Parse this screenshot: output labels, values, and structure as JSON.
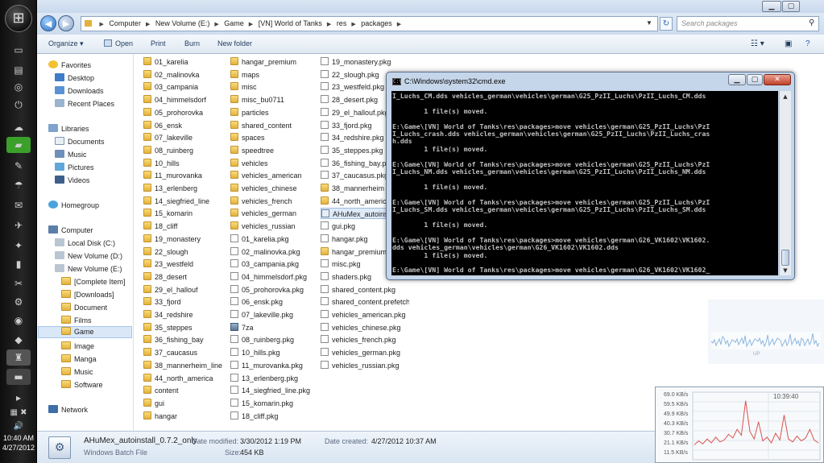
{
  "taskbar": {
    "clock_time": "10:40 AM",
    "clock_date": "4/27/2012"
  },
  "explorer": {
    "breadcrumb": [
      "Computer",
      "New Volume (E:)",
      "Game",
      "[VN] World of Tanks",
      "res",
      "packages"
    ],
    "search_placeholder": "Search packages",
    "toolbar": {
      "organize": "Organize",
      "open": "Open",
      "print": "Print",
      "burn": "Burn",
      "new_folder": "New folder"
    },
    "nav": {
      "favorites": "Favorites",
      "desktop": "Desktop",
      "downloads": "Downloads",
      "recent_places": "Recent Places",
      "libraries": "Libraries",
      "documents": "Documents",
      "music": "Music",
      "pictures": "Pictures",
      "videos": "Videos",
      "homegroup": "Homegroup",
      "computer": "Computer",
      "local_disk": "Local Disk (C:)",
      "volume_d": "New Volume (D:)",
      "volume_e": "New Volume (E:)",
      "complete_item": "[Complete Item]",
      "downloads_folder": "[Downloads]",
      "document": "Document",
      "films": "Films",
      "game": "Game",
      "image": "Image",
      "manga": "Manga",
      "music2": "Music",
      "software": "Software",
      "network": "Network"
    },
    "files_col1": [
      "01_karelia",
      "02_malinovka",
      "03_campania",
      "04_himmelsdorf",
      "05_prohorovka",
      "06_ensk",
      "07_lakeville",
      "08_ruinberg",
      "10_hills",
      "11_murovanka",
      "13_erlenberg",
      "14_siegfried_line",
      "15_komarin",
      "18_cliff",
      "19_monastery",
      "22_slough",
      "23_westfeld",
      "28_desert",
      "29_el_hallouf",
      "33_fjord",
      "34_redshire",
      "35_steppes",
      "36_fishing_bay",
      "37_caucasus",
      "38_mannerheim_line",
      "44_north_america",
      "content",
      "gui",
      "hangar"
    ],
    "files_col2": [
      "hangar_premium",
      "maps",
      "misc",
      "misc_bu0711",
      "particles",
      "shared_content",
      "spaces",
      "speedtree",
      "vehicles",
      "vehicles_american",
      "vehicles_chinese",
      "vehicles_french",
      "vehicles_german",
      "vehicles_russian",
      "01_karelia.pkg",
      "02_malinovka.pkg",
      "03_campania.pkg",
      "04_himmelsdorf.pkg",
      "05_prohorovka.pkg",
      "06_ensk.pkg",
      "07_lakeville.pkg",
      "7za",
      "08_ruinberg.pkg",
      "10_hills.pkg",
      "11_murovanka.pkg",
      "13_erlenberg.pkg",
      "14_siegfried_line.pkg",
      "15_komarin.pkg",
      "18_cliff.pkg"
    ],
    "files_col3": [
      "19_monastery.pkg",
      "22_slough.pkg",
      "23_westfeld.pkg",
      "28_desert.pkg",
      "29_el_hallouf.pkg",
      "33_fjord.pkg",
      "34_redshire.pkg",
      "35_steppes.pkg",
      "36_fishing_bay.p",
      "37_caucasus.pkg",
      "38_mannerheim",
      "44_north_americ",
      "AHuMex_autoinst",
      "gui.pkg",
      "hangar.pkg",
      "hangar_premium",
      "misc.pkg",
      "shaders.pkg",
      "shared_content.pkg",
      "shared_content.prefetch",
      "vehicles_american.pkg",
      "vehicles_chinese.pkg",
      "vehicles_french.pkg",
      "vehicles_german.pkg",
      "vehicles_russian.pkg"
    ],
    "details": {
      "name": "AHuMex_autoinstall_0.7.2_only",
      "type": "Windows Batch File",
      "modified_label": "Date modified:",
      "modified_value": "3/30/2012 1:19 PM",
      "size_label": "Size:",
      "size_value": "454 KB",
      "created_label": "Date created:",
      "created_value": "4/27/2012 10:37 AM"
    }
  },
  "cmd": {
    "title": "C:\\Windows\\system32\\cmd.exe",
    "lines": [
      "I_Luchs_CM.dds vehicles_german\\vehicles\\german\\G25_PzII_Luchs\\PzII_Luchs_CM.dds",
      "",
      "        1 file(s) moved.",
      "",
      "E:\\Game\\[VN] World of Tanks\\res\\packages>move vehicles\\german\\G25_PzII_Luchs\\PzI",
      "I_Luchs_crash.dds vehicles_german\\vehicles\\german\\G25_PzII_Luchs\\PzII_Luchs_cras",
      "h.dds",
      "        1 file(s) moved.",
      "",
      "E:\\Game\\[VN] World of Tanks\\res\\packages>move vehicles\\german\\G25_PzII_Luchs\\PzI",
      "I_Luchs_NM.dds vehicles_german\\vehicles\\german\\G25_PzII_Luchs\\PzII_Luchs_NM.dds",
      "",
      "        1 file(s) moved.",
      "",
      "E:\\Game\\[VN] World of Tanks\\res\\packages>move vehicles\\german\\G25_PzII_Luchs\\PzI",
      "I_Luchs_SM.dds vehicles_german\\vehicles\\german\\G25_PzII_Luchs\\PzII_Luchs_SM.dds",
      "",
      "        1 file(s) moved.",
      "",
      "E:\\Game\\[VN] World of Tanks\\res\\packages>move vehicles\\german\\G26_VK1602\\VK1602.",
      "dds vehicles_german\\vehicles\\german\\G26_VK1602\\VK1602.dds",
      "        1 file(s) moved.",
      "",
      "E:\\Game\\[VN] World of Tanks\\res\\packages>move vehicles\\german\\G26_VK1602\\VK1602_"
    ]
  },
  "netmon": {
    "time": "10:39:40",
    "levels": [
      "69.0 KB/s",
      "59.5 KB/s",
      "49.9 KB/s",
      "40.3 KB/s",
      "30.7 KB/s",
      "21.1 KB/s",
      "11.5 KB/s"
    ],
    "trace": [
      14,
      18,
      15,
      20,
      16,
      22,
      17,
      19,
      25,
      21,
      30,
      24,
      60,
      28,
      20,
      38,
      18,
      22,
      16,
      26,
      19,
      45,
      20,
      17,
      23,
      18,
      21,
      30,
      19,
      16
    ]
  },
  "gadget": {
    "label": "UP"
  },
  "colors": {
    "selection": "#d9e7f7",
    "taskbar": "#1a1a1a",
    "console_bg": "#000000",
    "console_fg": "#c0c0c0",
    "net_line": "#d9534f"
  }
}
